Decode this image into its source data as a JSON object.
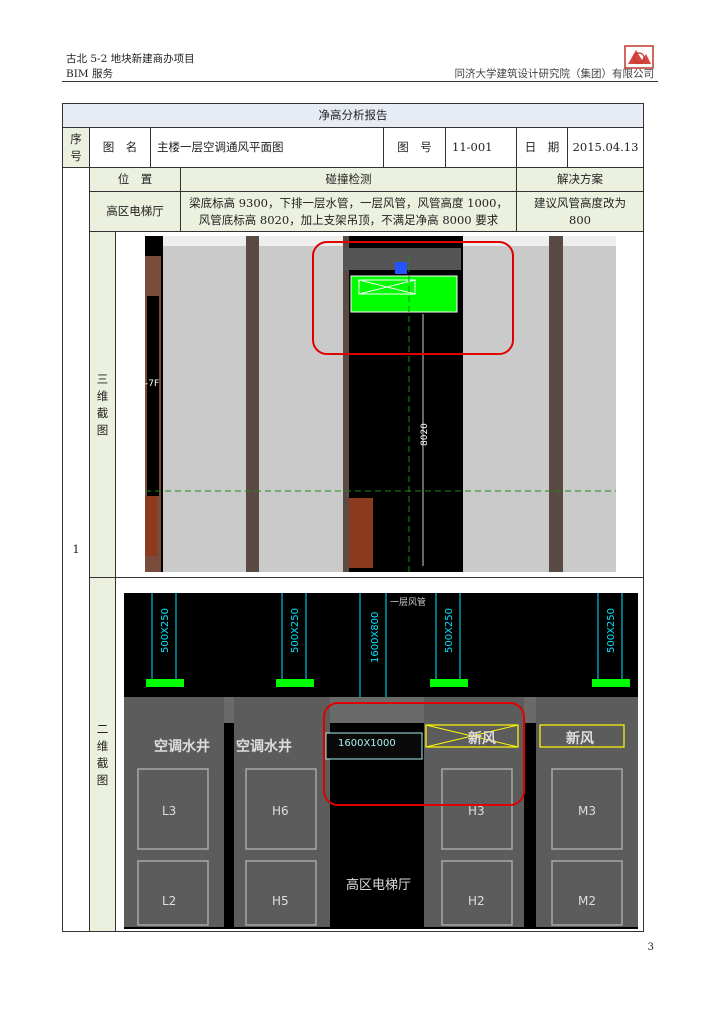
{
  "header": {
    "project_line1": "古北 5-2 地块新建商办项目",
    "project_line2": "BIM 服务",
    "org": "同济大学建筑设计研究院（集团）有限公司"
  },
  "report": {
    "title": "净高分析报告",
    "col_seq": "序号",
    "col_name_label": "图　名",
    "name_value": "主楼一层空调通风平面图",
    "col_no_label": "图　号",
    "no_value": "11-001",
    "col_date_label": "日　期",
    "date_value": "2015.04.13",
    "row_index": "1",
    "col_position": "位　置",
    "col_clash": "碰撞检测",
    "col_solution": "解决方案",
    "position_value": "高区电梯厅",
    "clash_value": "梁底标高 9300，下排一层水管，一层风管，风管高度 1000，风管底标高 8020，加上支架吊顶，不满足净高 8000 要求",
    "solution_value": "建议风管高度改为 800",
    "label_3d": "三维截图",
    "label_2d": "二维截图"
  },
  "view3d": {
    "dim_text": "8020",
    "left_tag": "-7F"
  },
  "view2d": {
    "duct_tags": [
      "500X250",
      "500X250",
      "1600X800",
      "500X250",
      "500X250"
    ],
    "shaft_labels": [
      "空调水井",
      "空调水井"
    ],
    "duct_label": "1600X1000",
    "fresh_air": [
      "新风",
      "新风"
    ],
    "rooms_top": [
      "L3",
      "H6",
      "H3",
      "M3"
    ],
    "rooms_bottom": [
      "L2",
      "H5",
      "H2",
      "M2"
    ],
    "hall": "高区电梯厅",
    "annot": "一层风管"
  },
  "page_number": "3",
  "colors": {
    "highlight": "#e00000",
    "grid_bg": "#ebf1de",
    "cad_green": "#00ff00"
  }
}
